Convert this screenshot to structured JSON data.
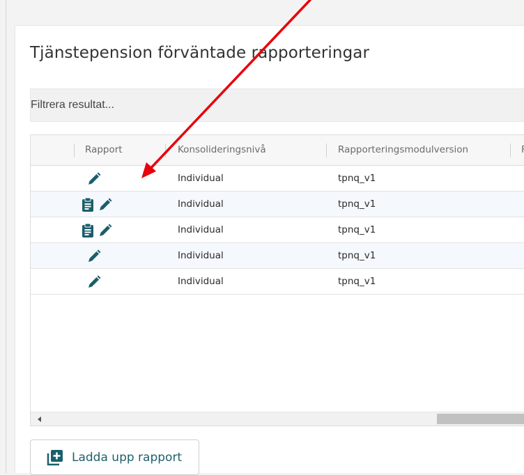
{
  "page": {
    "title": "Tjänstepension förväntade rapporteringar"
  },
  "filter": {
    "placeholder": "Filtrera resultat..."
  },
  "grid": {
    "columns": [
      {
        "key": "rapport",
        "label": "Rapport"
      },
      {
        "key": "konsolideringsniva",
        "label": "Konsolideringsnivå"
      },
      {
        "key": "rapporteringsmodulversion",
        "label": "Rapporteringsmodulversion"
      },
      {
        "key": "partial",
        "label": "F"
      }
    ],
    "rows": [
      {
        "icons": [
          "pencil-icon"
        ],
        "konsolideringsniva": "Individual",
        "rapporteringsmodulversion": "tpnq_v1"
      },
      {
        "icons": [
          "clipboard-icon",
          "pencil-icon"
        ],
        "konsolideringsniva": "Individual",
        "rapporteringsmodulversion": "tpnq_v1"
      },
      {
        "icons": [
          "clipboard-icon",
          "pencil-icon"
        ],
        "konsolideringsniva": "Individual",
        "rapporteringsmodulversion": "tpnq_v1"
      },
      {
        "icons": [
          "pencil-icon"
        ],
        "konsolideringsniva": "Individual",
        "rapporteringsmodulversion": "tpnq_v1"
      },
      {
        "icons": [
          "pencil-icon"
        ],
        "konsolideringsniva": "Individual",
        "rapporteringsmodulversion": "tpnq_v1"
      }
    ]
  },
  "upload_button": {
    "label": "Ladda upp rapport",
    "icon": "plus-square-icon"
  },
  "annotation": {
    "icon": "red-arrow-icon",
    "color": "#e8000b"
  },
  "colors": {
    "icon_teal": "#1b5e6b",
    "arrow_red": "#e8000b"
  }
}
